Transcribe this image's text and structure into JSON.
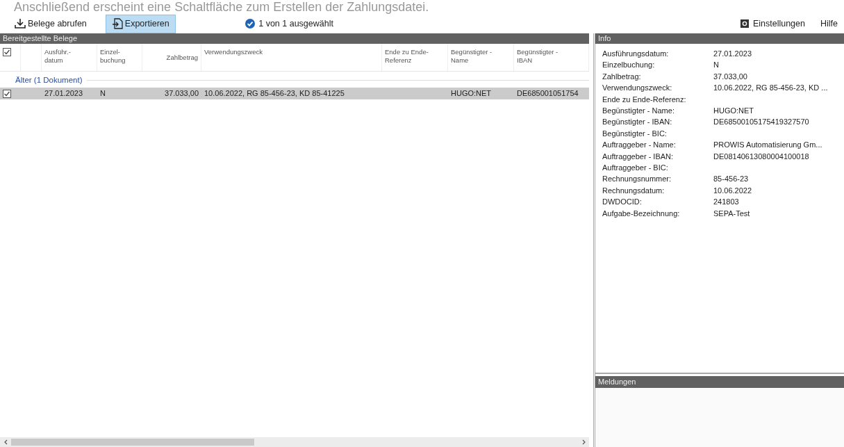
{
  "caption": "Anschließend erscheint eine Schaltfläche zum Erstellen der Zahlungsdatei.",
  "toolbar": {
    "buttons": [
      {
        "label": "Belege abrufen",
        "kind": "download",
        "selected": false
      },
      {
        "label": "Exportieren",
        "kind": "export",
        "selected": true
      }
    ],
    "status": "1 von 1 ausgewählt",
    "settings": "Einstellungen",
    "help": "Hilfe"
  },
  "table": {
    "title": "Bereitgestellte Belege",
    "all_checked": true,
    "columns": [
      {
        "label": "Ausführ.-\ndatum",
        "kind": "text"
      },
      {
        "label": "Einzel-\nbuchung",
        "kind": "text"
      },
      {
        "label": "Zahlbetrag",
        "kind": "amount"
      },
      {
        "label": "Verwendungszweck",
        "kind": "text"
      },
      {
        "label": "Ende zu Ende-\nReferenz",
        "kind": "text"
      },
      {
        "label": "Begünstigter -\nName",
        "kind": "text"
      },
      {
        "label": "Begünstigter -\nIBAN",
        "kind": "text"
      }
    ],
    "groups": [
      {
        "label": "Älter (1 Dokument)",
        "rows": [
          {
            "checked": true,
            "selected": true,
            "cells": [
              "27.01.2023",
              "N",
              "37.033,00",
              "10.06.2022, RG 85-456-23, KD 85-41225",
              "",
              "HUGO:NET",
              "DE685001051754"
            ]
          }
        ]
      }
    ]
  },
  "info": {
    "title": "Info",
    "fields": [
      {
        "label": "Ausführungsdatum:",
        "value": "27.01.2023"
      },
      {
        "label": "Einzelbuchung:",
        "value": "N"
      },
      {
        "label": "Zahlbetrag:",
        "value": "37.033,00"
      },
      {
        "label": "Verwendungszweck:",
        "value": "10.06.2022, RG 85-456-23, KD ..."
      },
      {
        "label": "Ende zu Ende-Referenz:"
      },
      {
        "label": "Begünstigter - Name:",
        "value": "HUGO:NET"
      },
      {
        "label": "Begünstigter - IBAN:",
        "value": "DE68500105175419327570"
      },
      {
        "label": "Begünstigter - BIC:"
      },
      {
        "label": "Auftraggeber - Name:",
        "value": "PROWIS Automatisierung Gm..."
      },
      {
        "label": "Auftraggeber - IBAN:",
        "value": "DE08140613080004100018"
      },
      {
        "label": "Auftraggeber - BIC:"
      },
      {
        "label": "Rechnungsnummer:",
        "value": "85-456-23"
      },
      {
        "label": "Rechnungsdatum:",
        "value": "10.06.2022"
      },
      {
        "label": "DWDOCID:",
        "value": "241803"
      },
      {
        "label": "Aufgabe-Bezeichnung:",
        "value": "SEPA-Test"
      }
    ]
  },
  "messages": {
    "title": "Meldungen"
  }
}
